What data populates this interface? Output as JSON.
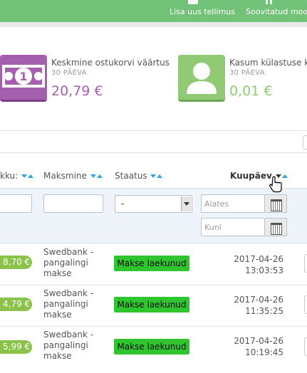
{
  "toolbar": {
    "add_order": "Lisa uus tellimus",
    "recommended": "Soovitatud moo"
  },
  "kpis": [
    {
      "title": "Keskmine ostukorvi väärtus",
      "period": "30 PÄEVA",
      "value": "20,79 €",
      "color": "#a460ad",
      "icon": "banknote-icon"
    },
    {
      "title": "Kasum külastuse ko",
      "period": "30 PÄEVA",
      "value": "0,01 €",
      "color": "#92c974",
      "icon": "user-icon"
    }
  ],
  "columns": {
    "total": "kku:",
    "payment": "Maksmine",
    "status": "Staatus",
    "date": "Kuupäev"
  },
  "filters": {
    "status_selected": "-",
    "date_from_placeholder": "Alates",
    "date_to_placeholder": "Kuni"
  },
  "rows": [
    {
      "total": "8,70 €",
      "payment": "Swedbank -pangalingi makse",
      "status": "Makse laekunud",
      "date": "2017-04-26",
      "time": "13:03:53"
    },
    {
      "total": "4,79 €",
      "payment": "Swedbank -pangalingi makse",
      "status": "Makse laekunud",
      "date": "2017-04-26",
      "time": "11:35:25"
    },
    {
      "total": "5,99 €",
      "payment": "Swedbank -pangalingi makse",
      "status": "Makse laekunud",
      "date": "2017-04-26",
      "time": "10:19:45"
    }
  ],
  "colors": {
    "toolbar": "#72c279",
    "sort_arrow": "#2ba6de",
    "status_paid": "#2fc52f",
    "total_badge": "#8bc34a"
  }
}
